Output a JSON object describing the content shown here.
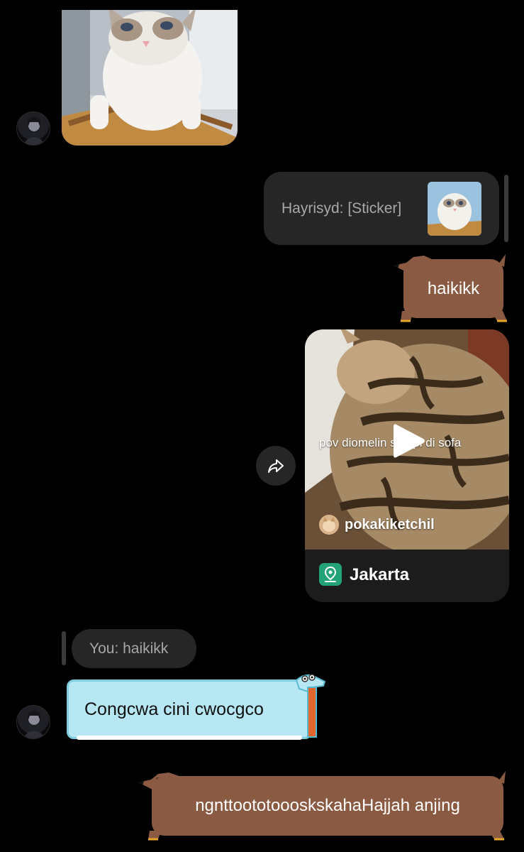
{
  "messages": {
    "sticker_image": {
      "icon": "cat-sticker-image"
    },
    "reply_1": {
      "text": "Hayrisyd: [Sticker]"
    },
    "sent_1": {
      "text": "haikikk",
      "bubble_color": "#8a5a43"
    },
    "video_share": {
      "caption": "pov diomelin     s pupi di sofa",
      "author": "pokakiketchil",
      "location": "Jakarta",
      "icon": "play-icon"
    },
    "reply_2": {
      "text": "You: haikikk"
    },
    "received_1": {
      "text": "Congcwa cini cwocgco",
      "bubble_color": "#b7e7f2"
    },
    "sent_2": {
      "text": "ngnttoototoooskskahaHajjah anjing",
      "bubble_color": "#8a5a43"
    }
  },
  "colors": {
    "background": "#000000",
    "reply_bubble": "#262626",
    "location_pin": "#24a37a"
  }
}
